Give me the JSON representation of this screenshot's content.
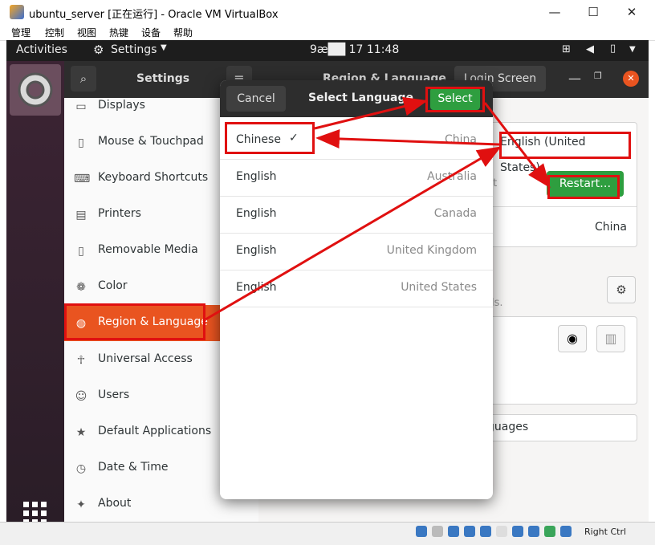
{
  "host": {
    "title": "ubuntu_server [正在运行] - Oracle VM VirtualBox",
    "menu": [
      "管理",
      "控制",
      "视图",
      "热键",
      "设备",
      "帮助"
    ],
    "minimize": "—",
    "maximize": "☐",
    "close": "✕"
  },
  "topbar": {
    "activities": "Activities",
    "app_menu": "Settings",
    "clock": "9æ██ 17 11:48"
  },
  "settings": {
    "sidebar_title": "Settings",
    "panel_title": "Region & Language",
    "login_screen": "Login Screen",
    "sidebar": [
      {
        "label": "Displays",
        "icon": "display-icon"
      },
      {
        "label": "Mouse & Touchpad",
        "icon": "mouse-icon"
      },
      {
        "label": "Keyboard Shortcuts",
        "icon": "keyboard-icon"
      },
      {
        "label": "Printers",
        "icon": "printer-icon"
      },
      {
        "label": "Removable Media",
        "icon": "usb-icon"
      },
      {
        "label": "Color",
        "icon": "color-icon"
      },
      {
        "label": "Region & Language",
        "icon": "globe-icon"
      },
      {
        "label": "Universal Access",
        "icon": "accessibility-icon"
      },
      {
        "label": "Users",
        "icon": "users-icon"
      },
      {
        "label": "Default Applications",
        "icon": "star-icon"
      },
      {
        "label": "Date & Time",
        "icon": "clock-icon"
      },
      {
        "label": "About",
        "icon": "sparkle-icon"
      }
    ],
    "language_value": "English (United States)",
    "restart_label": "Restart…",
    "restart_hint": "ct",
    "formats_value": "China",
    "input_hint": "ls.",
    "manage_languages": "guages"
  },
  "dialog": {
    "title": "Select Language",
    "cancel": "Cancel",
    "select": "Select",
    "languages": [
      {
        "name": "Chinese",
        "country": "China",
        "checked": true
      },
      {
        "name": "English",
        "country": "Australia"
      },
      {
        "name": "English",
        "country": "Canada"
      },
      {
        "name": "English",
        "country": "United Kingdom"
      },
      {
        "name": "English",
        "country": "United States"
      }
    ]
  },
  "statusbar": {
    "host_key": "Right Ctrl"
  },
  "colors": {
    "annotation_red": "#e01010",
    "select_green": "#2e9e3f",
    "highlight_orange": "#e95420"
  }
}
